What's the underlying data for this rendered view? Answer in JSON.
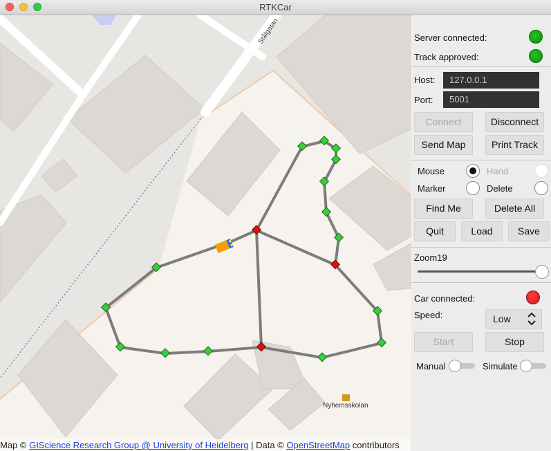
{
  "window": {
    "title": "RTKCar"
  },
  "map": {
    "street_label": "Stålgatan",
    "school_label": "Nyhemsskolan",
    "attribution": {
      "prefix": "Map © ",
      "link1": "GIScience Research Group @ University of Heidelberg",
      "middle": " | Data © ",
      "link2": "OpenStreetMap",
      "suffix": " contributors"
    },
    "colors": {
      "track": "#7c7c7c",
      "waypoint": "#3dcb3d",
      "junction": "#e01010",
      "car_body": "#f5a000",
      "car_front": "#2a6cff"
    }
  },
  "panel": {
    "server_connected_label": "Server connected:",
    "server_connected_status": "connected",
    "track_approved_label": "Track approved:",
    "track_approved_status": "approved",
    "host_label": "Host:",
    "host_value": "127.0.0.1",
    "port_label": "Port:",
    "port_value": "5001",
    "buttons": {
      "connect": "Connect",
      "disconnect": "Disconnect",
      "send_map": "Send Map",
      "print_track": "Print Track",
      "find_me": "Find Me",
      "delete_all": "Delete All",
      "quit": "Quit",
      "load": "Load",
      "save": "Save",
      "start": "Start",
      "stop": "Stop"
    },
    "modes": {
      "mouse": "Mouse",
      "hand": "Hand",
      "marker": "Marker",
      "delete": "Delete",
      "selected": "Mouse"
    },
    "zoom_label": "Zoom19",
    "zoom_fraction": 1.0,
    "car_connected_label": "Car connected:",
    "car_connected_status": "disconnected",
    "speed_label": "Speed:",
    "speed_value": "Low",
    "manual_label": "Manual",
    "manual_on": false,
    "simulate_label": "Simulate",
    "simulate_on": false
  }
}
